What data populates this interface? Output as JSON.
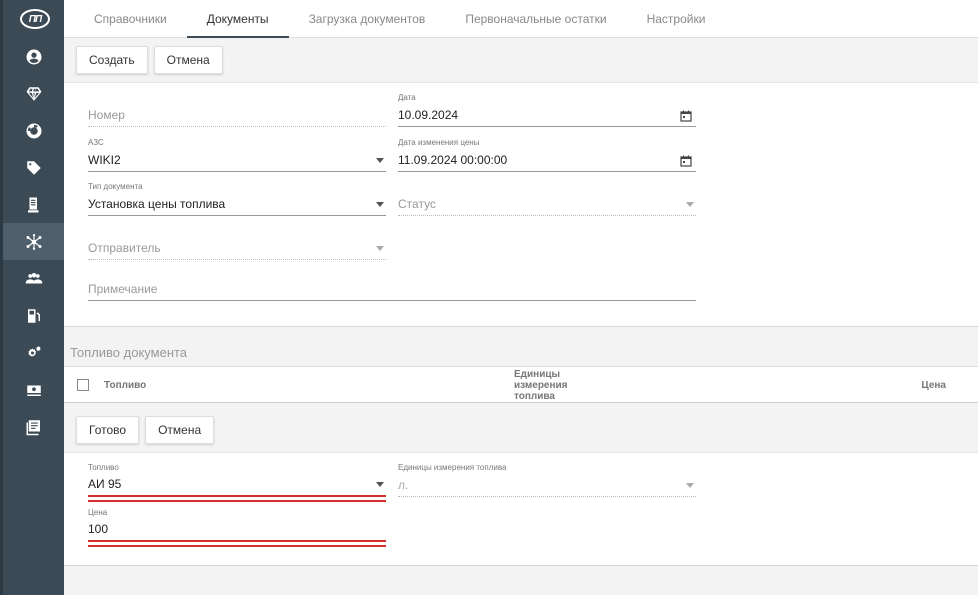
{
  "app": {
    "logo_text": "ПП"
  },
  "sidebar": {
    "items": [
      {
        "icon": "user-circle-icon"
      },
      {
        "icon": "diamond-icon"
      },
      {
        "icon": "lifebuoy-icon"
      },
      {
        "icon": "tag-icon"
      },
      {
        "icon": "document-icon"
      },
      {
        "icon": "network-icon",
        "active": true
      },
      {
        "icon": "users-icon"
      },
      {
        "icon": "fuel-pump-icon"
      },
      {
        "icon": "gears-icon"
      },
      {
        "icon": "money-icon"
      },
      {
        "icon": "list-icon"
      }
    ]
  },
  "tabs": [
    {
      "label": "Справочники"
    },
    {
      "label": "Документы",
      "active": true
    },
    {
      "label": "Загрузка документов"
    },
    {
      "label": "Первоначальные остатки"
    },
    {
      "label": "Настройки"
    }
  ],
  "toolbar": {
    "create_label": "Создать",
    "cancel_label": "Отмена"
  },
  "form": {
    "number": {
      "placeholder": "Номер"
    },
    "date": {
      "label": "Дата",
      "value": "10.09.2024"
    },
    "azs": {
      "label": "АЗС",
      "value": "WIKI2"
    },
    "price_change_date": {
      "label": "Дата изменения цены",
      "value": "11.09.2024 00:00:00"
    },
    "doc_type": {
      "label": "Тип документа",
      "value": "Установка цены топлива"
    },
    "status": {
      "placeholder": "Статус"
    },
    "sender": {
      "placeholder": "Отправитель"
    },
    "note": {
      "placeholder": "Примечание"
    }
  },
  "fuel_section": {
    "title": "Топливо документа",
    "columns": {
      "fuel": "Топливо",
      "units": "Единицы измерения топлива",
      "price": "Цена"
    }
  },
  "edit_toolbar": {
    "done_label": "Готово",
    "cancel_label": "Отмена"
  },
  "edit_form": {
    "fuel": {
      "label": "Топливо",
      "value": "АИ 95"
    },
    "units": {
      "label": "Единицы измерения топлива",
      "value": "л."
    },
    "price": {
      "label": "Цена",
      "value": "100"
    }
  },
  "colors": {
    "sidebar": "#3b4a55",
    "error_underline": "#d32f2f"
  }
}
